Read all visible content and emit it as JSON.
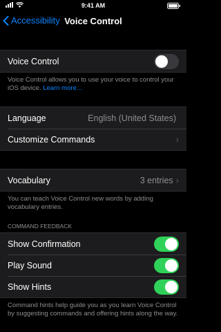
{
  "status_bar": {
    "time": "9:41 AM"
  },
  "nav": {
    "back_label": "Accessibility",
    "title": "Voice Control"
  },
  "voice_control": {
    "label": "Voice Control",
    "enabled": false,
    "footer_text": "Voice Control allows you to use your voice to control your iOS device.",
    "learn_more": "Learn more..."
  },
  "language": {
    "label": "Language",
    "value": "English (United States)"
  },
  "customize": {
    "label": "Customize Commands"
  },
  "vocabulary": {
    "label": "Vocabulary",
    "value": "3 entries",
    "footer_text": "You can teach Voice Control new words by adding vocabulary entries."
  },
  "command_feedback": {
    "header": "COMMAND FEEDBACK",
    "items": [
      {
        "label": "Show Confirmation",
        "enabled": true
      },
      {
        "label": "Play Sound",
        "enabled": true
      },
      {
        "label": "Show Hints",
        "enabled": true
      }
    ],
    "footer_text": "Command hints help guide you as you learn Voice Control by suggesting commands and offering hints along the way."
  },
  "colors": {
    "accent": "#0a84ff",
    "toggle_on": "#30d158",
    "background": "#000000",
    "cell": "#1c1c1e"
  }
}
